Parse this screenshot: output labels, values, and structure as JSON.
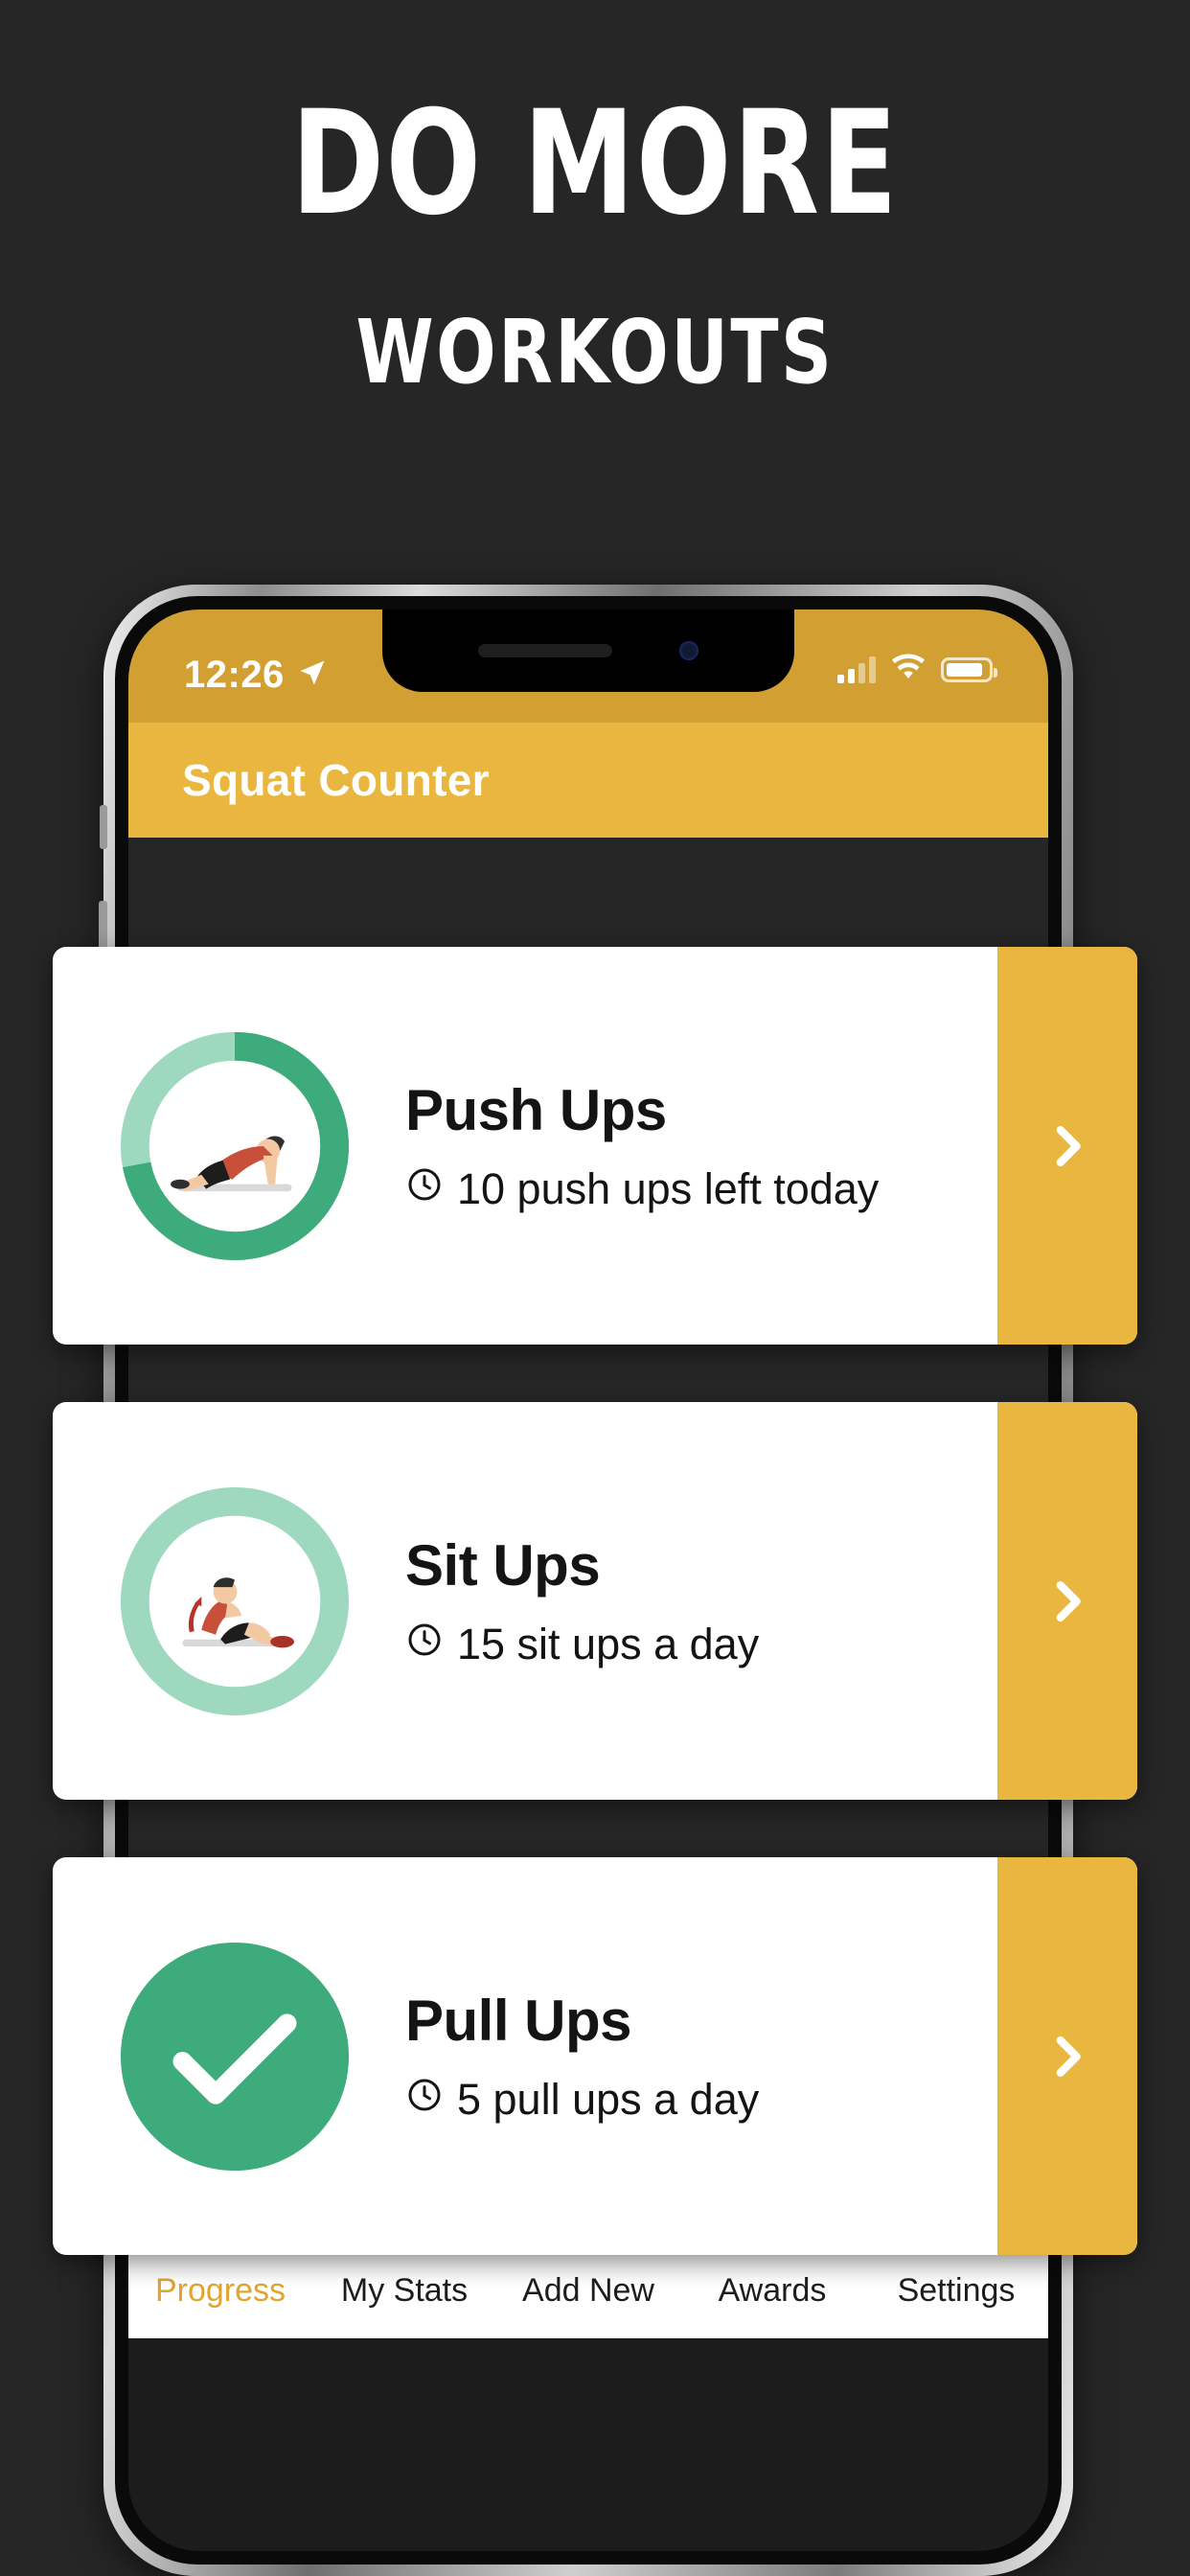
{
  "marketing": {
    "headline": "DO MORE",
    "subheadline": "WORKOUTS"
  },
  "colors": {
    "background": "#262626",
    "brand_yellow": "#e9b73f",
    "statusbar_yellow": "#d2a032",
    "progress_green": "#3dab7b",
    "progress_track": "#9ed9bf",
    "card_white": "#ffffff",
    "text_dark": "#141414"
  },
  "phone": {
    "statusbar": {
      "time": "12:26",
      "location_icon": "location-arrow-icon",
      "signal_icon": "cellular-signal-icon",
      "wifi_icon": "wifi-icon",
      "battery_icon": "battery-icon"
    },
    "appbar": {
      "title": "Squat Counter"
    }
  },
  "workouts": [
    {
      "title": "Push Ups",
      "subtitle": "10 push ups left today",
      "clock_icon": "clock-icon",
      "chevron_icon": "chevron-right-icon",
      "progress_percent": 72,
      "state": "in-progress",
      "figure_icon": "push-up-figure-icon"
    },
    {
      "title": "Sit Ups",
      "subtitle": "15 sit ups a day",
      "clock_icon": "clock-icon",
      "chevron_icon": "chevron-right-icon",
      "progress_percent": 0,
      "state": "not-started",
      "figure_icon": "sit-up-figure-icon"
    },
    {
      "title": "Pull Ups",
      "subtitle": "5 pull ups a day",
      "clock_icon": "clock-icon",
      "chevron_icon": "chevron-right-icon",
      "progress_percent": 100,
      "state": "complete",
      "figure_icon": "checkmark-icon"
    }
  ],
  "bottom_nav": {
    "fab": {
      "label": "add-new-fab",
      "icon": "plus-icon"
    },
    "items": [
      {
        "label": "Progress",
        "icon": "clock-icon",
        "active": true
      },
      {
        "label": "My Stats",
        "icon": "bar-chart-icon",
        "active": false
      },
      {
        "label": "Add New",
        "icon": "plus-icon",
        "active": false
      },
      {
        "label": "Awards",
        "icon": "trophy-icon",
        "active": false
      },
      {
        "label": "Settings",
        "icon": "gear-icon",
        "active": false
      }
    ]
  }
}
